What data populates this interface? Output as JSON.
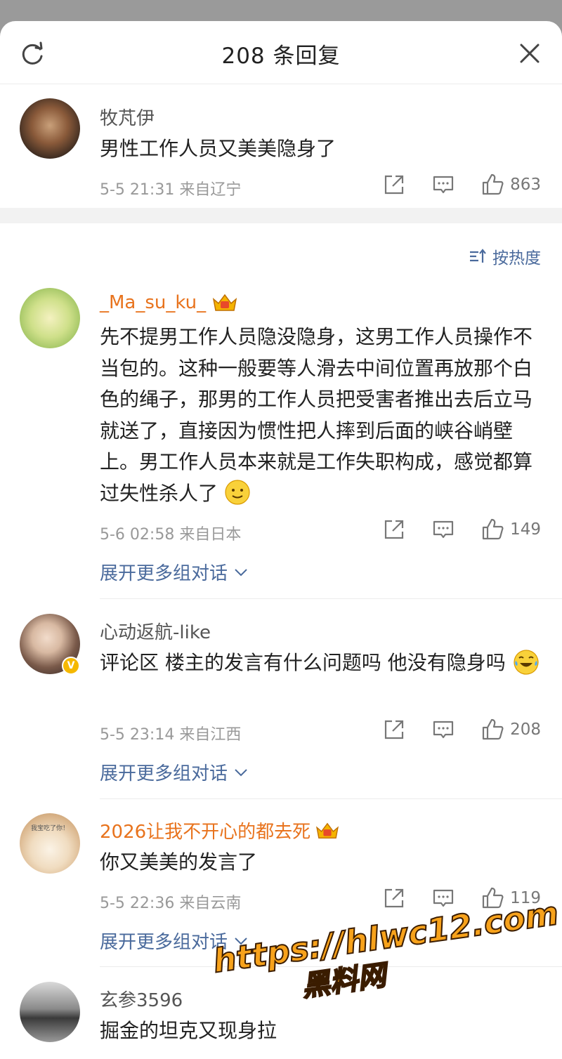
{
  "header": {
    "title": "208 条回复"
  },
  "original": {
    "username": "牧芃伊",
    "text": "男性工作人员又美美隐身了",
    "meta": "5-5 21:31  来自辽宁",
    "likes": "863"
  },
  "sort_label": "按热度",
  "expand_label": "展开更多组对话",
  "comments": [
    {
      "username": "_Ma_su_ku_",
      "text": "先不提男工作人员隐没隐身，这男工作人员操作不当包的。这种一般要等人滑去中间位置再放那个白色的绳子，那男的工作人员把受害者推出去后立马就送了，直接因为惯性把人摔到后面的峡谷峭壁上。男工作人员本来就是工作失职构成，感觉都算过失性杀人了",
      "meta": "5-6 02:58  来自日本",
      "likes": "149"
    },
    {
      "username": "心动返航-like",
      "text": "评论区 楼主的发言有什么问题吗 他没有隐身吗",
      "meta": "5-5 23:14  来自江西",
      "likes": "208"
    },
    {
      "username": "2026让我不开心的都去死",
      "text": "你又美美的发言了",
      "meta": "5-5 22:36  来自云南",
      "likes": "119",
      "avatar_text": "我宝吃了你！"
    },
    {
      "username": "玄参3596",
      "text": "掘金的坦克又现身拉"
    }
  ],
  "watermark": {
    "line1": "https://hlwc12.com",
    "line2": "黑料网"
  },
  "colors": {
    "accent_link": "#4a6a9c",
    "vip_name": "#e8731d",
    "like_gray": "#777777"
  },
  "icons": [
    "refresh-icon",
    "close-icon",
    "share-icon",
    "comment-icon",
    "like-icon",
    "sort-icon",
    "chevron-down-icon",
    "crown-badge-icon",
    "verified-badge-icon",
    "smile-emoji-icon",
    "laugh-cry-emoji-icon"
  ]
}
